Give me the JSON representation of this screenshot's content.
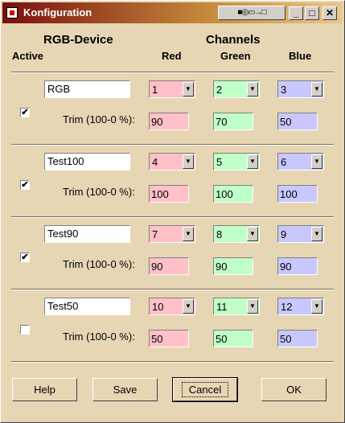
{
  "window": {
    "title": "Konfiguration",
    "toolbar_text": "■◎▭→□"
  },
  "titlebar_buttons": {
    "minimize": "_",
    "maximize": "□",
    "close": "✕"
  },
  "headers": {
    "rgb_device": "RGB-Device",
    "active": "Active",
    "channels": "Channels",
    "red": "Red",
    "green": "Green",
    "blue": "Blue"
  },
  "devices": [
    {
      "name": "RGB",
      "active": "✔",
      "red": "1",
      "green": "2",
      "blue": "3",
      "trim_label": "Trim (100-0 %):",
      "trim_red": "90",
      "trim_green": "70",
      "trim_blue": "50"
    },
    {
      "name": "Test100",
      "active": "✔",
      "red": "4",
      "green": "5",
      "blue": "6",
      "trim_label": "Trim (100-0 %):",
      "trim_red": "100",
      "trim_green": "100",
      "trim_blue": "100"
    },
    {
      "name": "Test90",
      "active": "✔",
      "red": "7",
      "green": "8",
      "blue": "9",
      "trim_label": "Trim (100-0 %):",
      "trim_red": "90",
      "trim_green": "90",
      "trim_blue": "90"
    },
    {
      "name": "Test50",
      "active": "",
      "red": "10",
      "green": "11",
      "blue": "12",
      "trim_label": "Trim (100-0 %):",
      "trim_red": "50",
      "trim_green": "50",
      "trim_blue": "50"
    }
  ],
  "buttons": {
    "help": "Help",
    "save": "Save",
    "cancel": "Cancel",
    "ok": "OK"
  },
  "dropdown_arrow": "▼"
}
